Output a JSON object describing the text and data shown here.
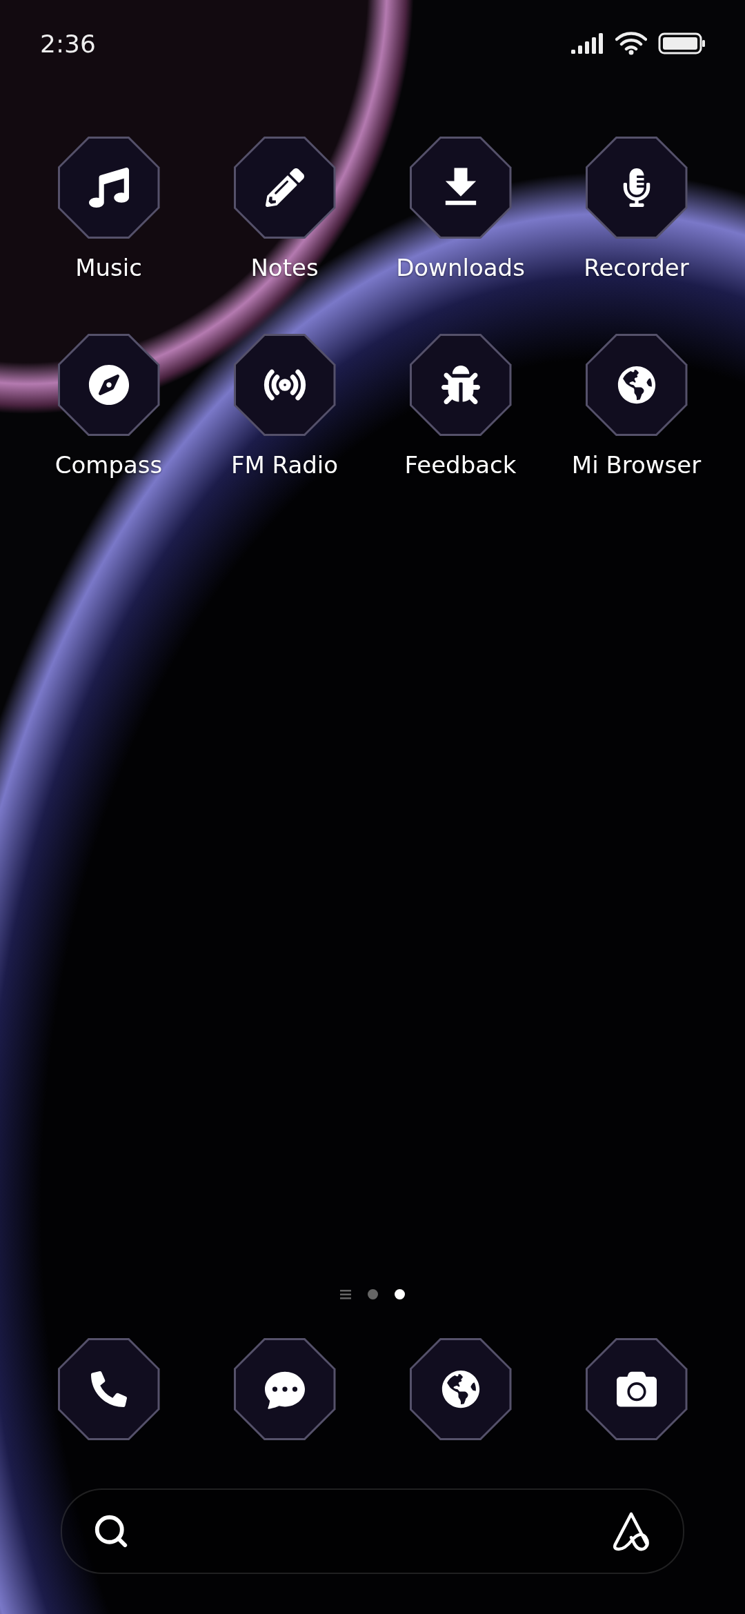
{
  "status_bar": {
    "time": "2:36"
  },
  "apps": [
    {
      "label": "Music",
      "kind": "music"
    },
    {
      "label": "Notes",
      "kind": "notes"
    },
    {
      "label": "Downloads",
      "kind": "downloads"
    },
    {
      "label": "Recorder",
      "kind": "recorder"
    },
    {
      "label": "Compass",
      "kind": "compass"
    },
    {
      "label": "FM Radio",
      "kind": "radio"
    },
    {
      "label": "Feedback",
      "kind": "feedback"
    },
    {
      "label": "Mi Browser",
      "kind": "browser"
    }
  ],
  "page_indicator": [
    {
      "kind": "list",
      "selected": false
    },
    {
      "kind": "dot",
      "selected": false
    },
    {
      "kind": "dot",
      "selected": true
    }
  ],
  "dock": [
    {
      "kind": "phone"
    },
    {
      "kind": "messages"
    },
    {
      "kind": "browser"
    },
    {
      "kind": "camera"
    }
  ]
}
